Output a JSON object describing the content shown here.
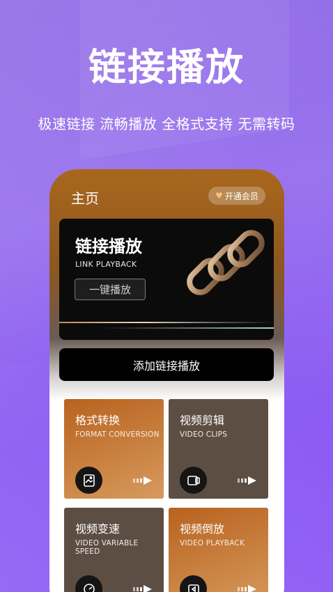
{
  "promo": {
    "headline": "链接播放",
    "subline": "极速链接  流畅播放  全格式支持  无需转码"
  },
  "app": {
    "home_title": "主页",
    "vip_label": "开通会员",
    "hero": {
      "title": "链接播放",
      "subtitle": "LINK PLAYBACK",
      "button": "一键播放"
    },
    "add_button": "添加链接播放",
    "cards": [
      {
        "title": "格式转换",
        "subtitle": "FORMAT CONVERSION",
        "icon": "image-file-icon",
        "color": "#c07a36"
      },
      {
        "title": "视频剪辑",
        "subtitle": "VIDEO CLIPS",
        "icon": "video-clip-icon",
        "color": "#5d4e44"
      },
      {
        "title": "视频变速",
        "subtitle": "VIDEO VARIABLE SPEED",
        "icon": "speed-icon",
        "color": "#5d4e44"
      },
      {
        "title": "视频倒放",
        "subtitle": "VIDEO PLAYBACK",
        "icon": "rewind-icon",
        "color": "#c07a36"
      }
    ]
  },
  "colors": {
    "background": "#9067ea",
    "accent_orange": "#c07a36",
    "card_gray": "#5d4e44"
  }
}
